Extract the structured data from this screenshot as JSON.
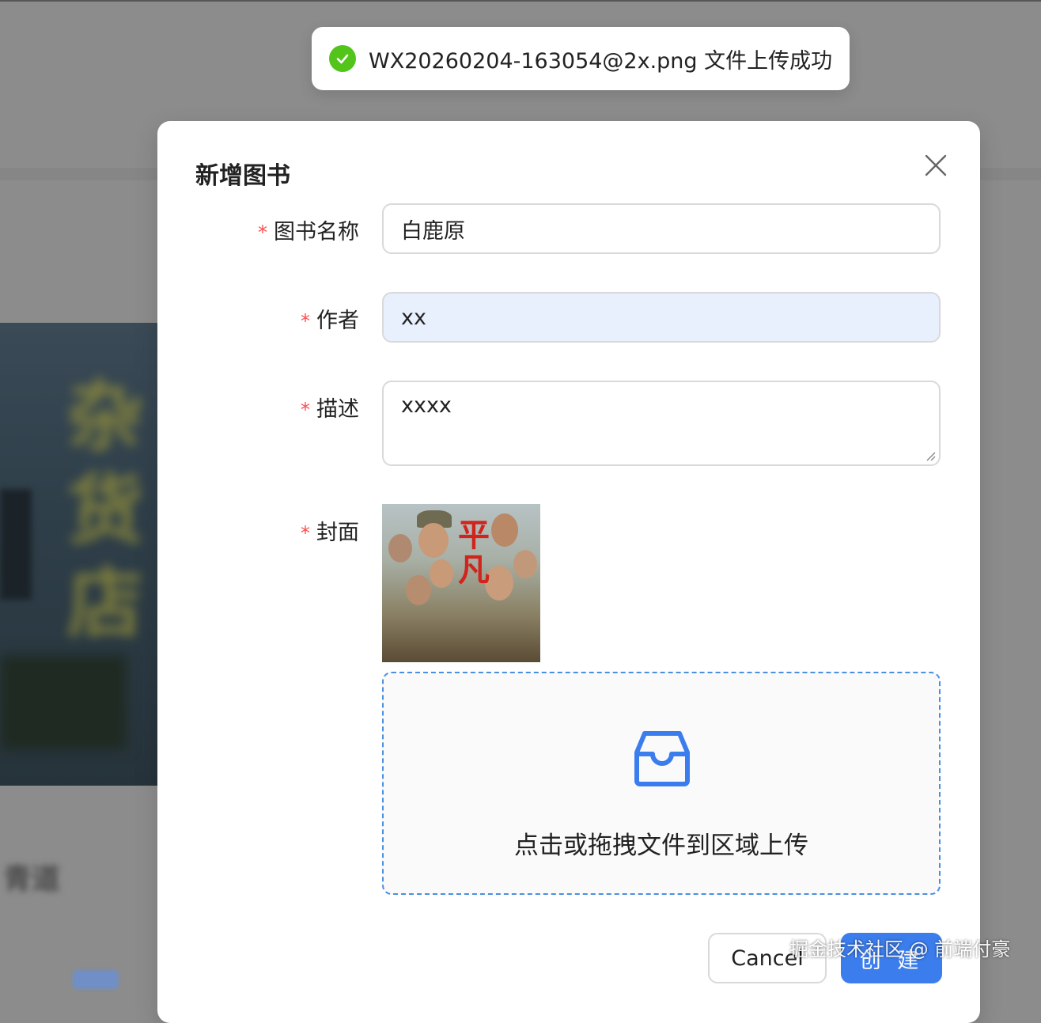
{
  "toast": {
    "message": "WX20260204-163054@2x.png 文件上传成功"
  },
  "modal": {
    "title": "新增图书"
  },
  "form": {
    "name": {
      "label": "图书名称",
      "value": "白鹿原"
    },
    "author": {
      "label": "作者",
      "value": "xx"
    },
    "description": {
      "label": "描述",
      "value": "xxxx"
    },
    "cover": {
      "label": "封面"
    },
    "required_mark": "*"
  },
  "upload": {
    "hint": "点击或拖拽文件到区域上传"
  },
  "footer": {
    "cancel_label": "Cancel",
    "create_label": "创 建"
  },
  "watermark": "掘金技术社区 @ 前端付豪",
  "colors": {
    "primary": "#3b7ded",
    "success": "#52c41a",
    "required": "#ff4d4f",
    "dropzone_border": "#4a8fe0",
    "autofill_bg": "#e8f0fe"
  }
}
